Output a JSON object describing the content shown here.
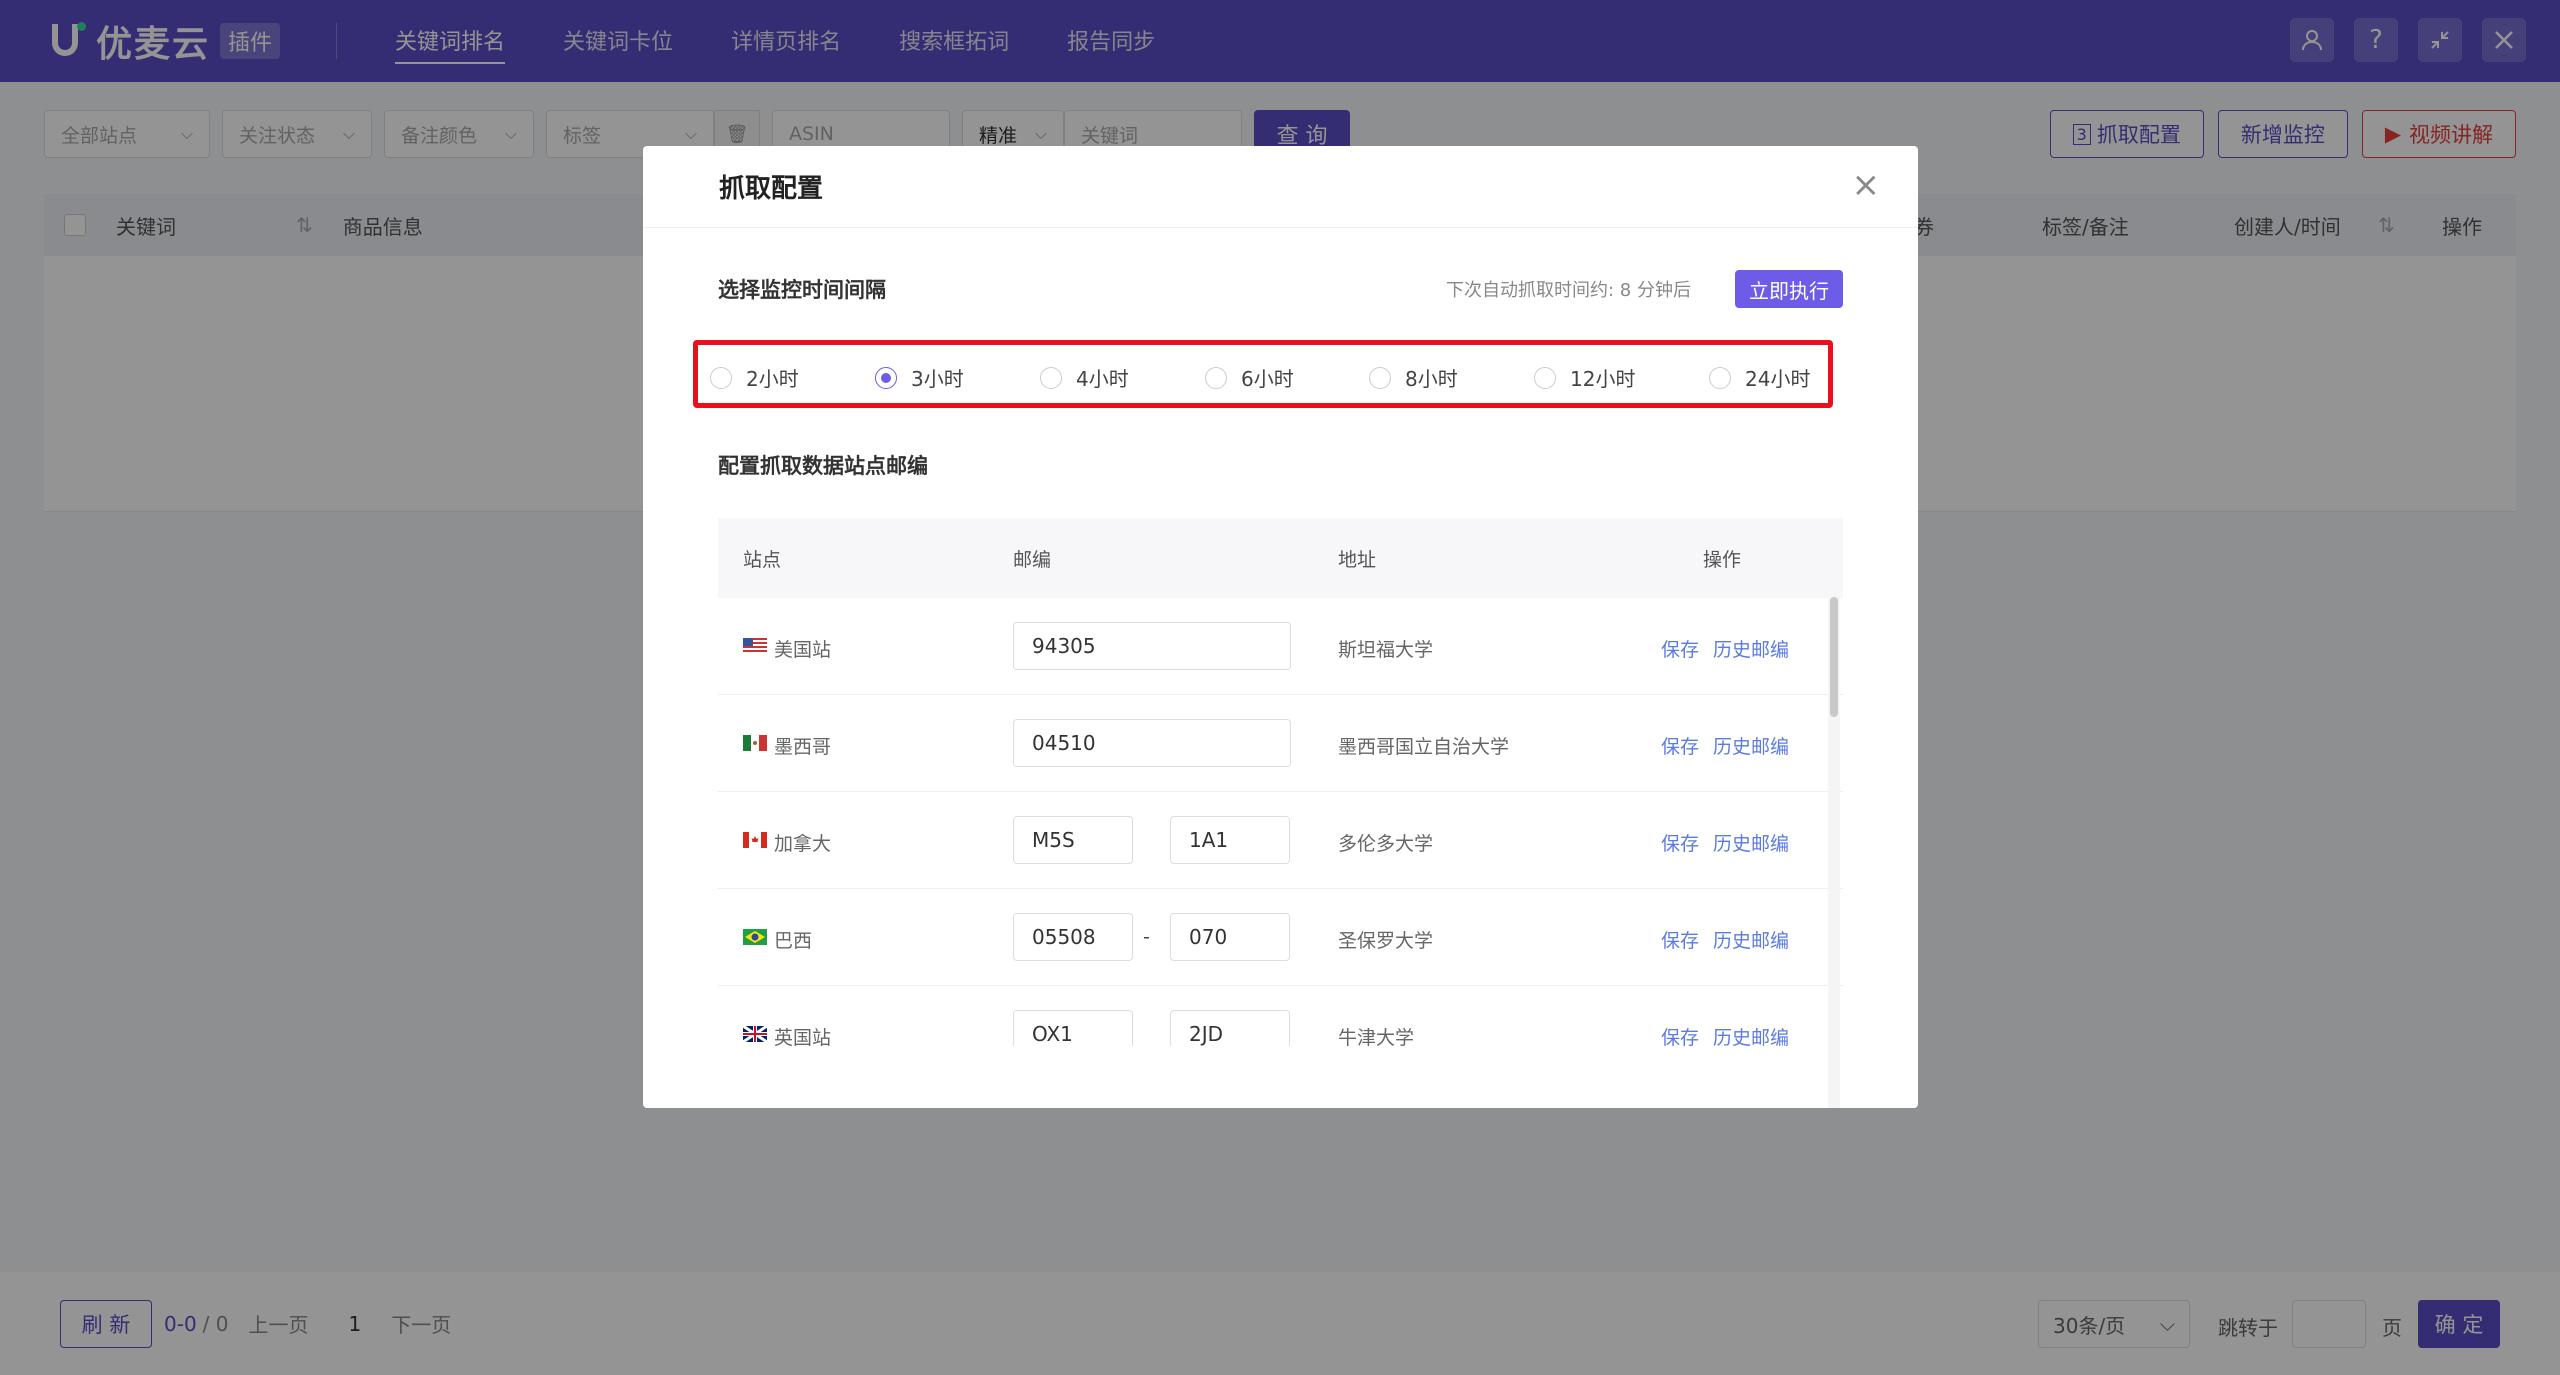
{
  "app": {
    "name": "优麦云",
    "badge": "插件"
  },
  "nav": [
    {
      "label": "关键词排名",
      "active": true
    },
    {
      "label": "关键词卡位"
    },
    {
      "label": "详情页排名"
    },
    {
      "label": "搜索框拓词"
    },
    {
      "label": "报告同步"
    }
  ],
  "top_icons": [
    "user-icon",
    "help-icon",
    "minimize-icon",
    "close-icon"
  ],
  "filters": {
    "site": "全部站点",
    "follow": "关注状态",
    "note_color": "备注颜色",
    "tag": "标签",
    "asin_placeholder": "ASIN",
    "match": "精准",
    "keyword_placeholder": "关键词",
    "query": "查 询"
  },
  "actions": {
    "crawl_config": "抓取配置",
    "add_monitor": "新增监控",
    "video": "视频讲解"
  },
  "table_head": {
    "keyword": "关键词",
    "product": "商品信息",
    "partial": "券",
    "tag_note": "标签/备注",
    "creator": "创建人/时间",
    "op": "操作"
  },
  "footer": {
    "refresh": "刷 新",
    "range": "0-0",
    "total": "/ 0",
    "prev": "上一页",
    "page": "1",
    "next": "下一页",
    "per_page": "30条/页",
    "jump": "跳转于",
    "unit": "页",
    "confirm": "确 定"
  },
  "modal": {
    "title": "抓取配置",
    "interval_title": "选择监控时间间隔",
    "next_time": "下次自动抓取时间约: 8 分钟后",
    "execute": "立即执行",
    "intervals": [
      {
        "label": "2小时",
        "checked": false
      },
      {
        "label": "3小时",
        "checked": true
      },
      {
        "label": "4小时",
        "checked": false
      },
      {
        "label": "6小时",
        "checked": false
      },
      {
        "label": "8小时",
        "checked": false
      },
      {
        "label": "12小时",
        "checked": false
      },
      {
        "label": "24小时",
        "checked": false
      }
    ],
    "zip_title": "配置抓取数据站点邮编",
    "columns": {
      "site": "站点",
      "zip": "邮编",
      "address": "地址",
      "op": "操作"
    },
    "rows": [
      {
        "site": "美国站",
        "zip1": "94305",
        "zip2": "",
        "address": "斯坦福大学",
        "flag": "us"
      },
      {
        "site": "墨西哥",
        "zip1": "04510",
        "zip2": "",
        "address": "墨西哥国立自治大学",
        "flag": "mx"
      },
      {
        "site": "加拿大",
        "zip1": "M5S",
        "zip2": "1A1",
        "address": "多伦多大学",
        "flag": "ca"
      },
      {
        "site": "巴西",
        "zip1": "05508",
        "zip2": "070",
        "address": "圣保罗大学",
        "flag": "br",
        "dash": "-"
      },
      {
        "site": "英国站",
        "zip1": "OX1",
        "zip2": "2JD",
        "address": "牛津大学",
        "flag": "uk"
      }
    ],
    "save": "保存",
    "history": "历史邮编"
  },
  "colors": {
    "brand": "#5b4fc7",
    "highlight": "#e8101a"
  }
}
